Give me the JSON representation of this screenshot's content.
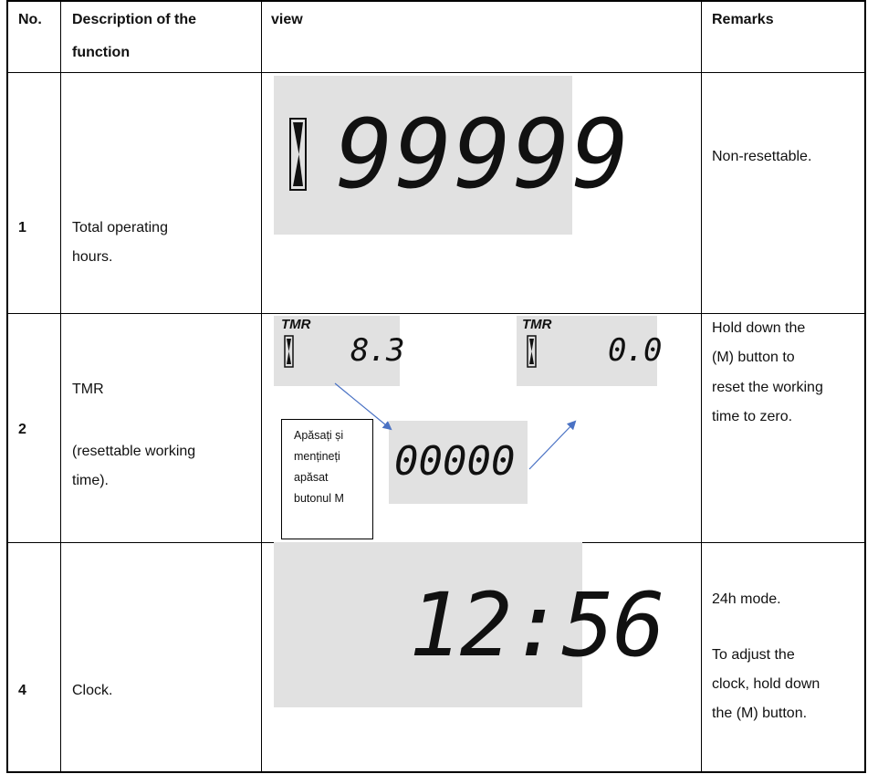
{
  "table": {
    "headers": {
      "no": "No.",
      "description_line1": "Description of the",
      "description_line2": "function",
      "view": "view",
      "remarks": "Remarks"
    },
    "rows": [
      {
        "no": "1",
        "description": [
          "Total operating",
          "hours."
        ],
        "display": {
          "icon": "hourglass-icon",
          "digits": "99999"
        },
        "remarks": [
          "Non-resettable."
        ]
      },
      {
        "no": "2",
        "description": [
          "TMR",
          "(resettable working",
          "time)."
        ],
        "display": {
          "before": {
            "label": "TMR",
            "icon": "hourglass-icon",
            "value": "8.3"
          },
          "after": {
            "label": "TMR",
            "icon": "hourglass-icon",
            "value": "0.0"
          },
          "center_digits": "00000",
          "note": [
            "Apăsați și",
            "mențineți",
            "apăsat",
            "butonul M"
          ]
        },
        "remarks": [
          "Hold down the",
          "(M) button to",
          "reset the working",
          "time to zero."
        ]
      },
      {
        "no": "4",
        "description": [
          "Clock."
        ],
        "display": {
          "time": "12:56"
        },
        "remarks": [
          "24h mode.",
          "To adjust the",
          "clock, hold down",
          "the (M) button."
        ]
      }
    ]
  },
  "colors": {
    "lcd_background": "#e1e1e1",
    "segment": "#111111",
    "arrow": "#4a72c4",
    "border": "#000000"
  }
}
